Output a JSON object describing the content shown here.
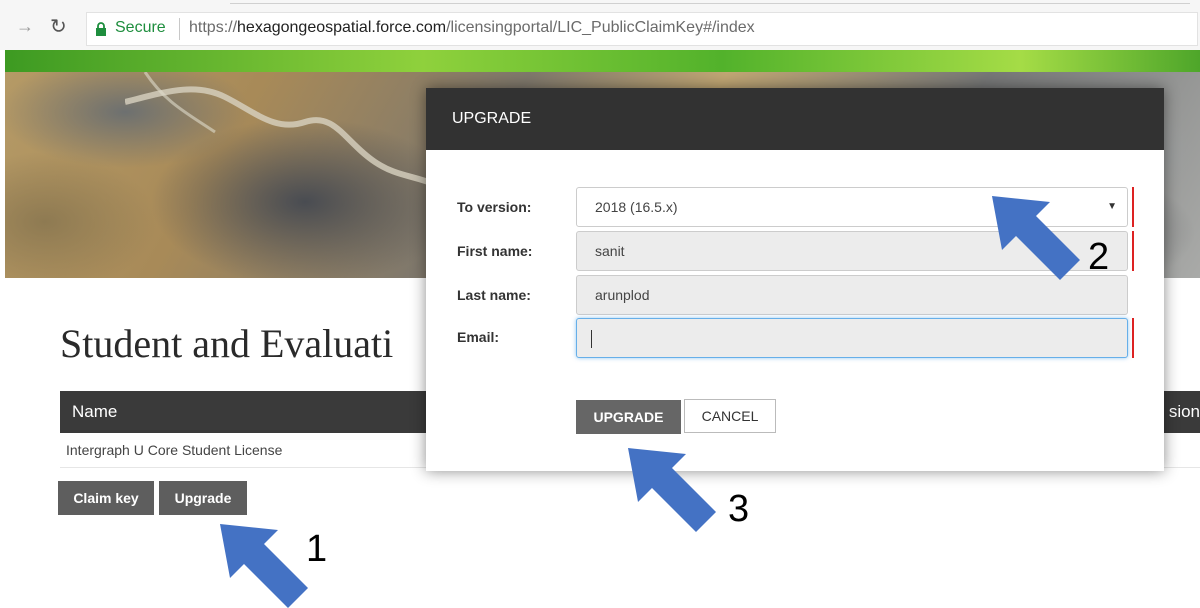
{
  "browser": {
    "secure_label": "Secure",
    "url_prefix": "https://",
    "url_host": "hexagongeospatial.force.com",
    "url_path": "/licensingportal/LIC_PublicClaimKey#/index"
  },
  "page": {
    "title": "Student and Evaluati",
    "table": {
      "headers": {
        "name": "Name",
        "version": "sion"
      },
      "rows": [
        {
          "name": "Intergraph U Core Student License"
        }
      ]
    },
    "buttons": {
      "claim_key": "Claim key",
      "upgrade": "Upgrade"
    }
  },
  "modal": {
    "title": "UPGRADE",
    "fields": {
      "to_version": {
        "label": "To version:",
        "value": "2018 (16.5.x)"
      },
      "first_name": {
        "label": "First name:",
        "value": "sanit"
      },
      "last_name": {
        "label": "Last name:",
        "value": "arunplod"
      },
      "email": {
        "label": "Email:",
        "value": ""
      }
    },
    "buttons": {
      "upgrade": "UPGRADE",
      "cancel": "CANCEL"
    }
  },
  "annotations": {
    "steps": [
      "1",
      "2",
      "3"
    ],
    "arrow_color": "#4472c4"
  }
}
